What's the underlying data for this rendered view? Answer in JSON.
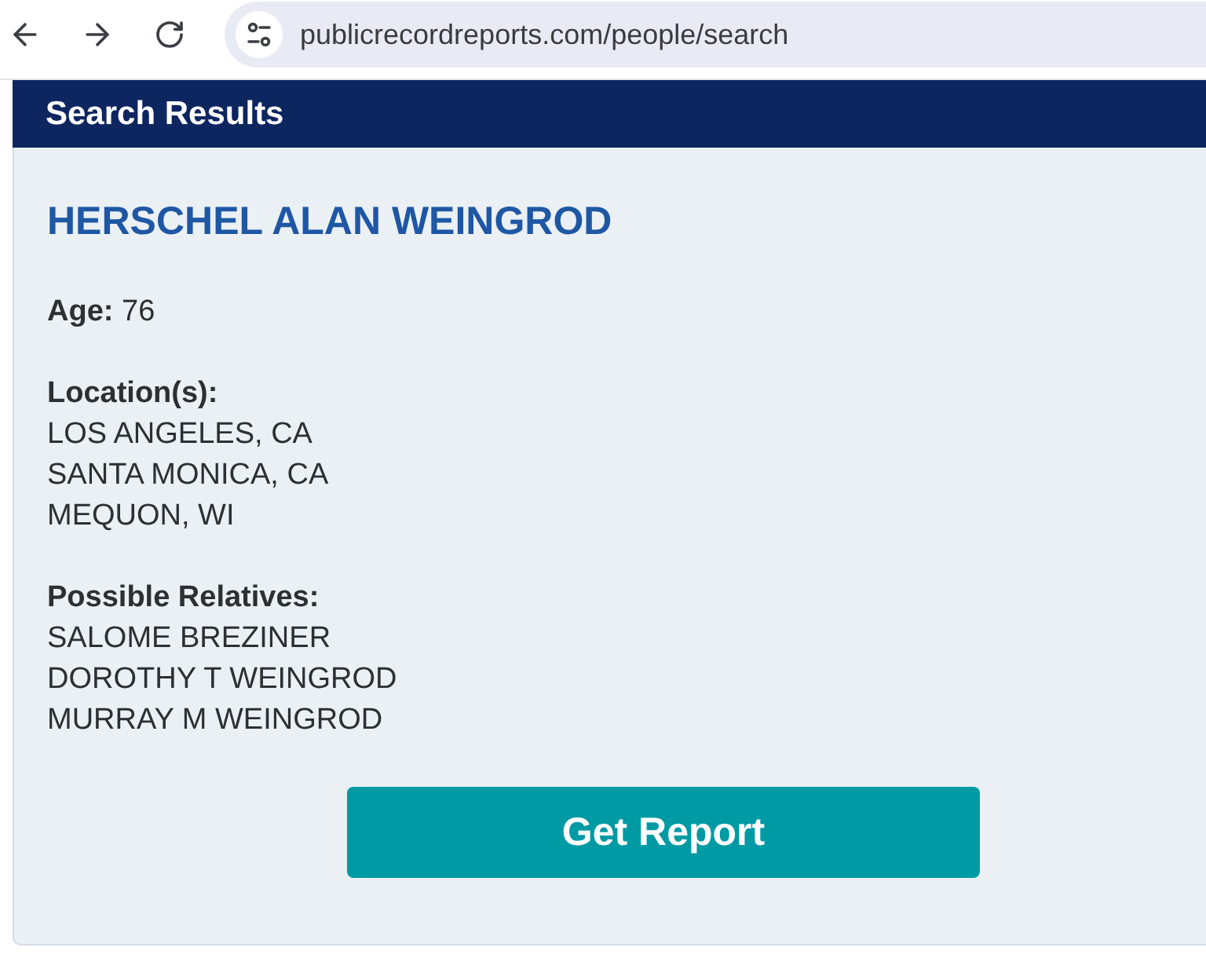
{
  "browser": {
    "url": "publicrecordreports.com/people/search"
  },
  "panel": {
    "title": "Search Results"
  },
  "person": {
    "name": "HERSCHEL ALAN WEINGROD",
    "sections": [
      {
        "kind": "inline",
        "text": "**Age:** 76"
      },
      {
        "kind": "list",
        "label": "Location(s):",
        "items": [
          "LOS ANGELES, CA",
          "SANTA MONICA, CA",
          "MEQUON, WI"
        ]
      },
      {
        "kind": "list",
        "label": "Possible Relatives:",
        "items": [
          "SALOME BREZINER",
          "DOROTHY T WEINGROD",
          "MURRAY M WEINGROD"
        ]
      }
    ]
  },
  "action": {
    "label": "Get Report"
  }
}
